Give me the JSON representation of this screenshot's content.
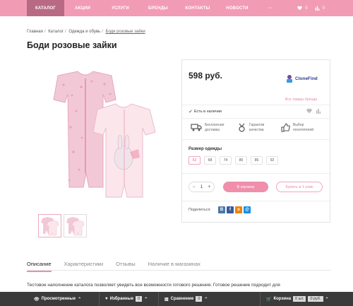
{
  "nav": {
    "items": [
      "КАТАЛОГ",
      "АКЦИИ",
      "УСЛУГИ",
      "БРЕНДЫ",
      "КОНТАКТЫ",
      "НОВОСТИ",
      "···"
    ],
    "wishlist_count": "0",
    "compare_count": "0"
  },
  "breadcrumbs": [
    "Главная",
    "Каталог",
    "Одежда и обувь",
    "Боди розовые зайки"
  ],
  "product": {
    "title": "Боди розовые зайки",
    "price": "598 руб.",
    "brand_name": "CloneFind",
    "brand_link": "Все товары бренда",
    "stock": "Есть в наличии",
    "features": [
      {
        "line1": "Бесплатная",
        "line2": "доставка"
      },
      {
        "line1": "Гарантия",
        "line2": "качества"
      },
      {
        "line1": "Выбор",
        "line2": "посетителей"
      }
    ],
    "size_label": "Размер одежды",
    "sizes": [
      "62",
      "68",
      "74",
      "80",
      "86",
      "92"
    ],
    "selected_size": "62",
    "qty": "1",
    "qty_minus": "−",
    "qty_plus": "+",
    "add_to_cart": "В корзину",
    "buy_one_click": "Купить в 1 клик",
    "share_label": "Поделиться:",
    "share_icons": [
      "vk-icon",
      "facebook-icon",
      "odnoklassniki-icon",
      "mail-icon"
    ]
  },
  "tabs": [
    "Описание",
    "Характеристики",
    "Отзывы",
    "Наличие в магазинах"
  ],
  "description": "Тестовое наполнение каталога позволяет увидеть все возможности готового решения. Готовое решение подходит для",
  "bottom_bar": {
    "viewed": "Просмотренные",
    "favorites": "Избранные",
    "favorites_count": "0",
    "compare": "Сравнение",
    "compare_count": "0",
    "cart": "Корзина",
    "cart_count": "0 шт.",
    "cart_sum": "0 руб."
  },
  "colors": {
    "accent": "#f29bb5",
    "nav_active": "#b86a84",
    "button": "#ef8fac",
    "bottom": "#3b3b3b"
  }
}
